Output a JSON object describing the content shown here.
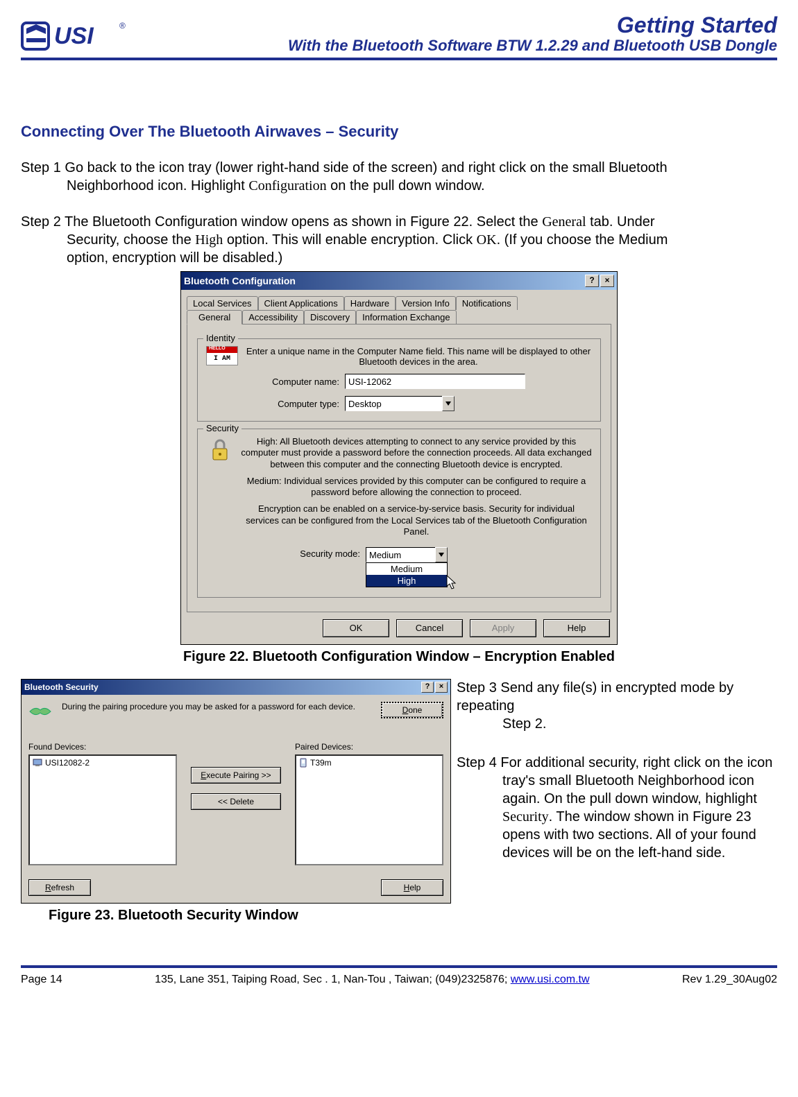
{
  "header": {
    "title": "Getting Started",
    "subtitle": "With the Bluetooth Software BTW 1.2.29 and Bluetooth USB Dongle",
    "logo_text": "USI",
    "logo_r": "®"
  },
  "section_heading": "Connecting Over The Bluetooth Airwaves – Security",
  "step1": {
    "label": "Step 1",
    "line1": "Go back to the icon tray (lower right-hand side of the screen) and right click on the small Bluetooth",
    "line2": "Neighborhood icon. Highlight ",
    "config_word": "Configuration",
    "line2b": " on the pull down window."
  },
  "step2": {
    "label": "Step 2",
    "line1a": "The Bluetooth Configuration window opens as shown in Figure 22. Select the ",
    "general_word": "General",
    "line1b": " tab. Under",
    "line2a": "Security, choose the ",
    "high_word": "High",
    "line2b": " option. This will enable encryption. Click ",
    "ok_word": "OK",
    "line2c": ". (If you choose the Medium",
    "line3": "option, encryption will be disabled.)"
  },
  "bt_config": {
    "title": "Bluetooth Configuration",
    "help_btn": "?",
    "close_btn": "×",
    "tabs_row1": [
      "Local Services",
      "Client Applications",
      "Hardware",
      "Version Info",
      "Notifications"
    ],
    "tabs_row2": [
      "General",
      "Accessibility",
      "Discovery",
      "Information Exchange"
    ],
    "identity": {
      "legend": "Identity",
      "iam": "I AM",
      "hello": "HELLO",
      "desc": "Enter a unique name in the Computer Name field. This name will be displayed to other Bluetooth devices in the area.",
      "name_label": "Computer name:",
      "name_value": "USI-12062",
      "type_label": "Computer type:",
      "type_value": "Desktop"
    },
    "security": {
      "legend": "Security",
      "high_text": "High: All Bluetooth devices attempting to connect to any service provided by this computer must provide a password before the connection proceeds. All data exchanged between this computer and the connecting Bluetooth device is encrypted.",
      "medium_text": "Medium: Individual services provided by this computer can be configured to require a password before allowing the connection to proceed.",
      "enc_text": "Encryption can be enabled on a service-by-service basis. Security for individual services can be configured from the Local Services tab of the Bluetooth Configuration Panel.",
      "mode_label": "Security mode:",
      "value": "Medium",
      "option_medium": "Medium",
      "option_high": "High"
    },
    "buttons": {
      "ok": "OK",
      "cancel": "Cancel",
      "apply": "Apply",
      "help": "Help"
    }
  },
  "fig22_caption": "Figure 22. Bluetooth Configuration Window – Encryption Enabled",
  "bt_sec": {
    "title": "Bluetooth Security",
    "help_btn": "?",
    "close_btn": "×",
    "pair_msg": "During the pairing procedure you may be asked for a password for each device.",
    "done": "Done",
    "found_label": "Found Devices:",
    "found_item": "USI12082-2",
    "paired_label": "Paired Devices:",
    "paired_item": "T39m",
    "exec": "Execute Pairing >>",
    "delete": "<< Delete",
    "refresh": "Refresh",
    "help": "Help"
  },
  "fig23_caption": "Figure 23. Bluetooth Security Window",
  "step3": {
    "label": "Step 3",
    "line1": "Send any file(s) in encrypted mode by repeating",
    "line2": "Step 2."
  },
  "step4": {
    "label": "Step 4",
    "line1": "For additional security, right click on the icon",
    "line2": "tray's small Bluetooth Neighborhood icon",
    "line3": "again. On the pull down window, highlight",
    "security_word": "Security",
    "line4": ". The window shown in Figure 23",
    "line5": "opens with two sections. All of your found",
    "line6": "devices will be on the left-hand side."
  },
  "footer": {
    "page": "Page 14",
    "addr": "135, Lane 351, Taiping Road, Sec . 1, Nan-Tou , Taiwan; (049)2325876; ",
    "url": "www.usi.com.tw",
    "rev": "Rev 1.29_30Aug02"
  }
}
